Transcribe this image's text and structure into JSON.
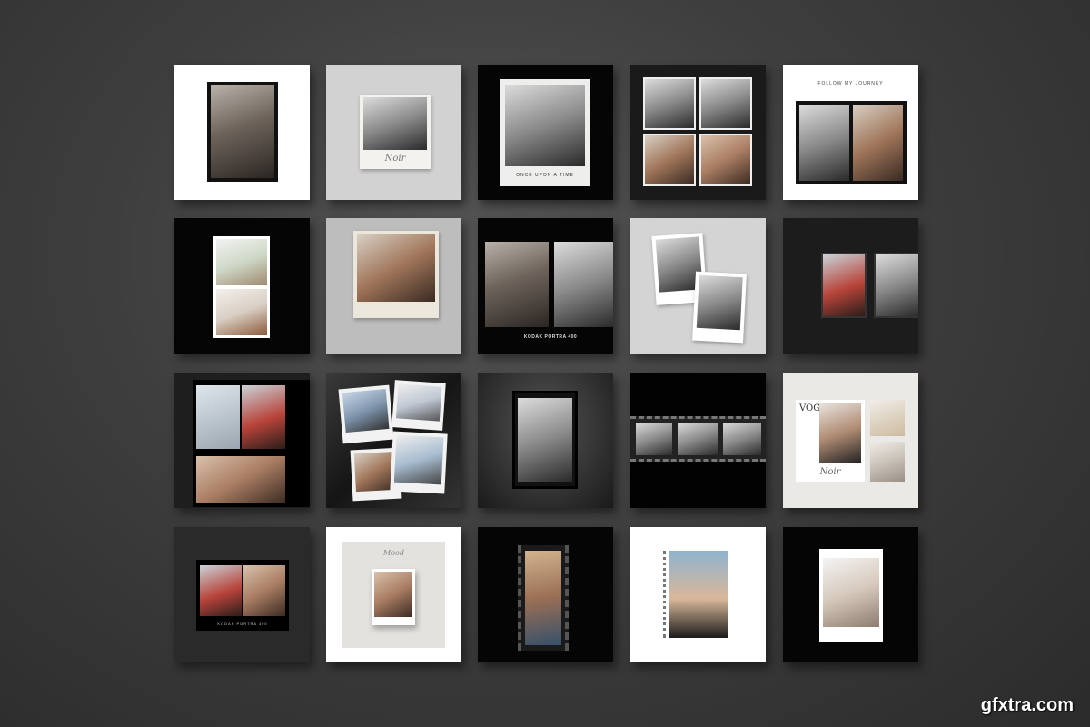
{
  "templates": {
    "t2_script": "Noir",
    "t3_caption": "ONCE UPON A TIME",
    "t5_caption": "FOLLOW MY JOURNEY",
    "t8_caption": "KODAK PORTRA 400",
    "t15_magazine": "VOGUE",
    "t15_script": "Noir",
    "t16_caption": "KODAK PORTRA 400",
    "t17_script": "Mood"
  },
  "watermark": "gfxtra.com"
}
